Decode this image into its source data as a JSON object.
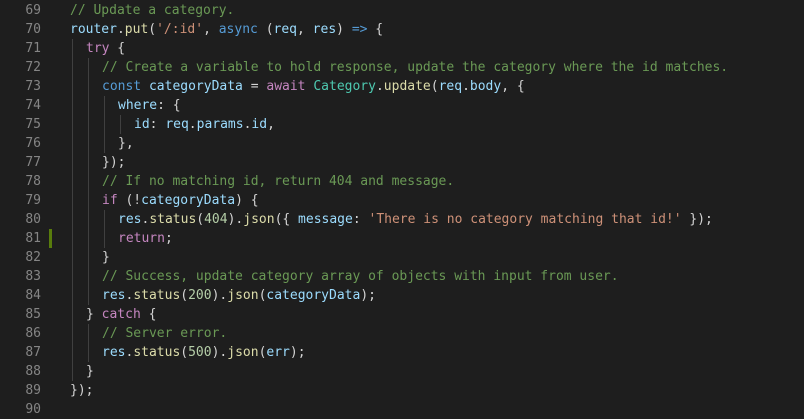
{
  "editor": {
    "language": "javascript",
    "modified_line": 81,
    "colors": {
      "background": "#1e1e1e",
      "line_number": "#858585",
      "comment": "#6a9955",
      "keyword": "#c586c0",
      "storage": "#569cd6",
      "function": "#dcdcaa",
      "variable": "#9cdcfe",
      "string": "#ce9178",
      "number": "#b5cea8",
      "class": "#4ec9b0",
      "plain": "#d4d4d4",
      "git_modified": "#587c0c"
    },
    "lines": [
      {
        "number": "69",
        "indent": 0,
        "tokens": [
          [
            "comment",
            "// Update a category."
          ]
        ]
      },
      {
        "number": "70",
        "indent": 0,
        "tokens": [
          [
            "var",
            "router"
          ],
          [
            "plain",
            "."
          ],
          [
            "func",
            "put"
          ],
          [
            "plain",
            "("
          ],
          [
            "string",
            "'/:id'"
          ],
          [
            "plain",
            ", "
          ],
          [
            "storage",
            "async"
          ],
          [
            "plain",
            " ("
          ],
          [
            "var",
            "req"
          ],
          [
            "plain",
            ", "
          ],
          [
            "var",
            "res"
          ],
          [
            "plain",
            ") "
          ],
          [
            "storage",
            "=>"
          ],
          [
            "plain",
            " {"
          ]
        ]
      },
      {
        "number": "71",
        "indent": 1,
        "tokens": [
          [
            "keyword",
            "try"
          ],
          [
            "plain",
            " {"
          ]
        ]
      },
      {
        "number": "72",
        "indent": 2,
        "tokens": [
          [
            "comment",
            "// Create a variable to hold response, update the category where the id matches."
          ]
        ]
      },
      {
        "number": "73",
        "indent": 2,
        "tokens": [
          [
            "storage",
            "const"
          ],
          [
            "plain",
            " "
          ],
          [
            "var",
            "categoryData"
          ],
          [
            "plain",
            " = "
          ],
          [
            "keyword",
            "await"
          ],
          [
            "plain",
            " "
          ],
          [
            "class",
            "Category"
          ],
          [
            "plain",
            "."
          ],
          [
            "func",
            "update"
          ],
          [
            "plain",
            "("
          ],
          [
            "var",
            "req"
          ],
          [
            "plain",
            "."
          ],
          [
            "var",
            "body"
          ],
          [
            "plain",
            ", {"
          ]
        ]
      },
      {
        "number": "74",
        "indent": 3,
        "tokens": [
          [
            "var",
            "where"
          ],
          [
            "plain",
            ": {"
          ]
        ]
      },
      {
        "number": "75",
        "indent": 4,
        "tokens": [
          [
            "var",
            "id"
          ],
          [
            "plain",
            ": "
          ],
          [
            "var",
            "req"
          ],
          [
            "plain",
            "."
          ],
          [
            "var",
            "params"
          ],
          [
            "plain",
            "."
          ],
          [
            "var",
            "id"
          ],
          [
            "plain",
            ","
          ]
        ]
      },
      {
        "number": "76",
        "indent": 3,
        "tokens": [
          [
            "plain",
            "},"
          ]
        ]
      },
      {
        "number": "77",
        "indent": 2,
        "tokens": [
          [
            "plain",
            "});"
          ]
        ]
      },
      {
        "number": "78",
        "indent": 2,
        "tokens": [
          [
            "comment",
            "// If no matching id, return 404 and message."
          ]
        ]
      },
      {
        "number": "79",
        "indent": 2,
        "tokens": [
          [
            "keyword",
            "if"
          ],
          [
            "plain",
            " (!"
          ],
          [
            "var",
            "categoryData"
          ],
          [
            "plain",
            ") {"
          ]
        ]
      },
      {
        "number": "80",
        "indent": 3,
        "tokens": [
          [
            "var",
            "res"
          ],
          [
            "plain",
            "."
          ],
          [
            "func",
            "status"
          ],
          [
            "plain",
            "("
          ],
          [
            "num",
            "404"
          ],
          [
            "plain",
            ")."
          ],
          [
            "func",
            "json"
          ],
          [
            "plain",
            "({ "
          ],
          [
            "var",
            "message"
          ],
          [
            "plain",
            ": "
          ],
          [
            "string",
            "'There is no category matching that id!'"
          ],
          [
            "plain",
            " });"
          ]
        ]
      },
      {
        "number": "81",
        "indent": 3,
        "tokens": [
          [
            "keyword",
            "return"
          ],
          [
            "plain",
            ";"
          ]
        ]
      },
      {
        "number": "82",
        "indent": 2,
        "tokens": [
          [
            "plain",
            "}"
          ]
        ]
      },
      {
        "number": "83",
        "indent": 2,
        "tokens": [
          [
            "comment",
            "// Success, update category array of objects with input from user."
          ]
        ]
      },
      {
        "number": "84",
        "indent": 2,
        "tokens": [
          [
            "var",
            "res"
          ],
          [
            "plain",
            "."
          ],
          [
            "func",
            "status"
          ],
          [
            "plain",
            "("
          ],
          [
            "num",
            "200"
          ],
          [
            "plain",
            ")."
          ],
          [
            "func",
            "json"
          ],
          [
            "plain",
            "("
          ],
          [
            "var",
            "categoryData"
          ],
          [
            "plain",
            ");"
          ]
        ]
      },
      {
        "number": "85",
        "indent": 1,
        "tokens": [
          [
            "plain",
            "} "
          ],
          [
            "keyword",
            "catch"
          ],
          [
            "plain",
            " {"
          ]
        ]
      },
      {
        "number": "86",
        "indent": 2,
        "tokens": [
          [
            "comment",
            "// Server error."
          ]
        ]
      },
      {
        "number": "87",
        "indent": 2,
        "tokens": [
          [
            "var",
            "res"
          ],
          [
            "plain",
            "."
          ],
          [
            "func",
            "status"
          ],
          [
            "plain",
            "("
          ],
          [
            "num",
            "500"
          ],
          [
            "plain",
            ")."
          ],
          [
            "func",
            "json"
          ],
          [
            "plain",
            "("
          ],
          [
            "var",
            "err"
          ],
          [
            "plain",
            ");"
          ]
        ]
      },
      {
        "number": "88",
        "indent": 1,
        "tokens": [
          [
            "plain",
            "}"
          ]
        ]
      },
      {
        "number": "89",
        "indent": 0,
        "tokens": [
          [
            "plain",
            "});"
          ]
        ]
      },
      {
        "number": "90",
        "indent": 0,
        "tokens": []
      }
    ]
  }
}
